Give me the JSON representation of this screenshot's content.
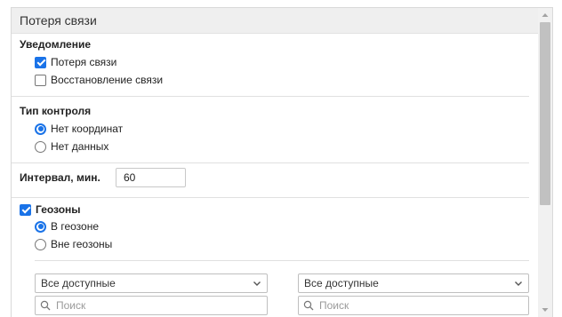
{
  "panel": {
    "title": "Потеря связи"
  },
  "notification": {
    "title": "Уведомление",
    "options": [
      {
        "label": "Потеря связи",
        "checked": true
      },
      {
        "label": "Восстановление связи",
        "checked": false
      }
    ]
  },
  "control_type": {
    "title": "Тип контроля",
    "options": [
      {
        "label": "Нет координат",
        "selected": true
      },
      {
        "label": "Нет данных",
        "selected": false
      }
    ]
  },
  "interval": {
    "label": "Интервал, мин.",
    "value": "60"
  },
  "geozones": {
    "label": "Геозоны",
    "checked": true,
    "options": [
      {
        "label": "В геозоне",
        "selected": true
      },
      {
        "label": "Вне геозоны",
        "selected": false
      }
    ]
  },
  "filters": {
    "left": {
      "select_value": "Все доступные",
      "search_placeholder": "Поиск"
    },
    "right": {
      "select_value": "Все доступные",
      "search_placeholder": "Поиск"
    }
  },
  "colors": {
    "accent": "#1a73e8",
    "header_bg": "#efefef",
    "scrollbar_thumb": "#c1c1c1"
  },
  "icons": {
    "chevron": "chevron-down-icon",
    "search": "search-icon",
    "scroll_up": "arrow-up-icon",
    "scroll_down": "arrow-down-icon"
  }
}
